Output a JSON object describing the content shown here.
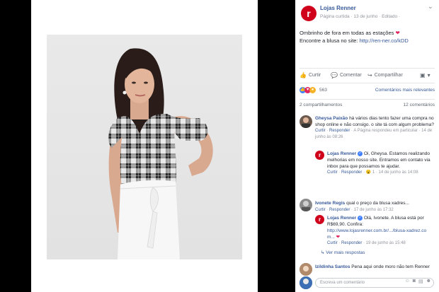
{
  "post": {
    "page_name": "Lojas Renner",
    "logo_letter": "r",
    "meta": "Página curtida · 13 de junho · Editado ·",
    "menu": "⌄",
    "text_line1": "Ombrinho de fora em todas as estações",
    "text_line2_prefix": "Encontre a blusa no site: ",
    "text_link": "http://ren-ner.co/kDD",
    "heart": "❤"
  },
  "actions": {
    "like": "Curtir",
    "comment": "Comentar",
    "share": "Compartilhar"
  },
  "reactions": {
    "count": "563",
    "sort_label": "Comentários mais relevantes"
  },
  "stats": {
    "shares": "2 compartilhamentos",
    "comments": "12 comentários"
  },
  "comments": [
    {
      "author": "Gheysa Paixão",
      "text": "há vários dias tento fazer uma compra no shop online e não consigo. o site tá com algum problema?",
      "meta_like": "Curtir",
      "meta_reply": "Responder",
      "meta_rest": "A Página respondeu em particular · 14 de junho às 08:26"
    },
    {
      "author": "Lojas Renner",
      "text": "Oi, Gheysa. Estamos realizando melhorias em nosso site. Entramos em contato via inbox para que possamos te ajudar.",
      "meta_like": "Curtir",
      "meta_reply": "Responder",
      "meta_reaction": "😮 1",
      "meta_time": "14 de junho às 14:08"
    },
    {
      "author": "Ivonete Regis",
      "text": "qual o preço da blusa xadres...",
      "meta_like": "Curtir",
      "meta_reply": "Responder",
      "meta_time": "17 de junho às 17:32"
    },
    {
      "author": "Lojas Renner",
      "text": "Olá, Ivonete. A blusa está por R$69,90. Confira:",
      "link": "http://www.lojasrenner.com.br/.../blusa-xadrez.com...",
      "meta_like": "Curtir",
      "meta_reply": "Responder",
      "meta_time": "19 de junho às 15:48"
    },
    {
      "author": "Izildinha Santos",
      "text": "Pena aqui onde moro não tem Renner"
    }
  ],
  "more_replies": "Ver mais respostas",
  "composer": {
    "placeholder": "Escreva um comentário"
  },
  "colors": {
    "facebook_blue": "#365899",
    "renner_red": "#d0021b",
    "like_blue": "#4080ff",
    "love_red": "#e0245e"
  }
}
